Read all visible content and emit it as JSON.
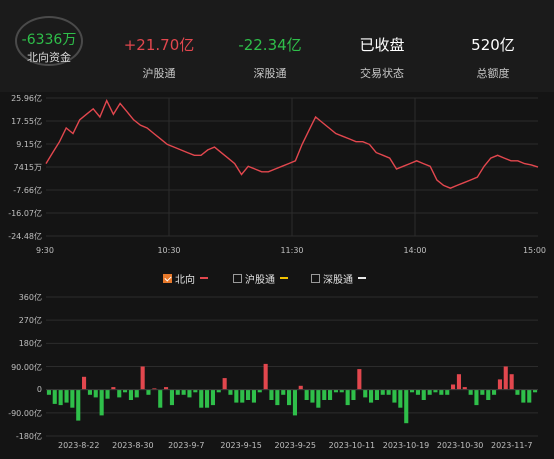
{
  "header": {
    "northbound_value": "-6336万",
    "northbound_label": "北向资金",
    "stats": [
      {
        "value": "+21.70亿",
        "label": "沪股通"
      },
      {
        "value": "-22.34亿",
        "label": "深股通"
      },
      {
        "value": "已收盘",
        "label": "交易状态"
      },
      {
        "value": "520亿",
        "label": "总额度"
      }
    ]
  },
  "colors": {
    "red": "#e2474e",
    "green": "#2fbf4a",
    "line": "#e2474e",
    "sh_legend": "#f2c200",
    "sz_legend": "#e8e8e8"
  },
  "chart_data": [
    {
      "type": "line",
      "y_ticks": [
        "25.96亿",
        "17.55亿",
        "9.15亿",
        "7415万",
        "-7.66亿",
        "-16.07亿",
        "-24.48亿"
      ],
      "y_tick_values": [
        25.96,
        17.55,
        9.15,
        0.74,
        -7.66,
        -16.07,
        -24.48
      ],
      "x_ticks": [
        "9:30",
        "10:30",
        "11:30",
        "14:00",
        "15:00"
      ],
      "ylim": [
        -24.48,
        25.96
      ],
      "series": [
        {
          "name": "北向",
          "values": [
            2,
            6,
            10,
            15,
            13,
            18,
            20,
            22,
            19,
            25,
            20,
            24,
            21,
            18,
            16,
            15,
            13,
            11,
            9,
            8,
            7,
            6,
            5,
            5,
            7,
            8,
            6,
            4,
            2,
            -2,
            1,
            0,
            -1,
            -1,
            0,
            1,
            2,
            3,
            9,
            14,
            19,
            17,
            15,
            13,
            12,
            11,
            10,
            10,
            9,
            6,
            5,
            4,
            0,
            1,
            2,
            3,
            2,
            1,
            -4,
            -6,
            -7,
            -6,
            -5,
            -4,
            -3,
            1,
            4,
            5,
            4,
            3,
            3,
            2,
            1.5,
            0.7
          ]
        }
      ]
    },
    {
      "type": "bar",
      "y_ticks": [
        "360亿",
        "270亿",
        "180亿",
        "90.00亿",
        "0",
        "-90.00亿",
        "-180亿"
      ],
      "y_tick_values": [
        360,
        270,
        180,
        90,
        0,
        -90,
        -180
      ],
      "x_ticks": [
        "2023-8-22",
        "2023-8-30",
        "2023-9-7",
        "2023-9-15",
        "2023-9-25",
        "2023-10-11",
        "2023-10-19",
        "2023-10-30",
        "2023-11-7"
      ],
      "ylim": [
        -180,
        360
      ],
      "values": [
        -20,
        -55,
        -60,
        -50,
        -70,
        -120,
        50,
        -20,
        -30,
        -100,
        -35,
        10,
        -30,
        -10,
        -40,
        -30,
        90,
        -20,
        5,
        -70,
        10,
        -60,
        -20,
        -20,
        -30,
        -10,
        -70,
        -70,
        -60,
        -10,
        45,
        -20,
        -50,
        -50,
        -40,
        -50,
        -10,
        100,
        -40,
        -60,
        -20,
        -60,
        -100,
        15,
        -40,
        -50,
        -70,
        -40,
        -40,
        -10,
        -10,
        -60,
        -40,
        80,
        -30,
        -50,
        -40,
        -20,
        -20,
        -50,
        -70,
        -130,
        -10,
        -20,
        -40,
        -20,
        -10,
        -20,
        -20,
        20,
        60,
        10,
        -20,
        -60,
        -20,
        -40,
        -20,
        40,
        90,
        60,
        -20,
        -50,
        -50,
        -10
      ]
    }
  ],
  "legend": [
    {
      "label": "北向",
      "checked": true
    },
    {
      "label": "沪股通",
      "checked": false
    },
    {
      "label": "深股通",
      "checked": false
    }
  ]
}
